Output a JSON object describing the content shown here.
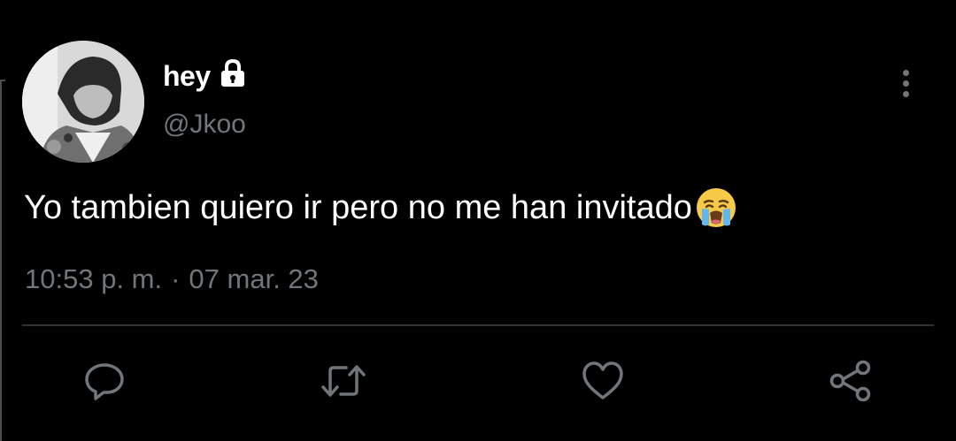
{
  "tweet": {
    "display_name": "hey",
    "handle": "@Jkoo",
    "text": "Yo tambien quiero ir pero no me han invitado",
    "time": "10:53 p. m.",
    "separator": "·",
    "date": "07 mar. 23",
    "emoji": "loudly-crying-face",
    "locked": true
  },
  "actions": [
    {
      "name": "reply",
      "icon": "reply-icon"
    },
    {
      "name": "retweet",
      "icon": "retweet-icon"
    },
    {
      "name": "like",
      "icon": "heart-icon"
    },
    {
      "name": "share",
      "icon": "share-icon"
    }
  ],
  "colors": {
    "background": "#000000",
    "text": "#ffffff",
    "muted": "#71767b",
    "divider": "#2f3336"
  }
}
